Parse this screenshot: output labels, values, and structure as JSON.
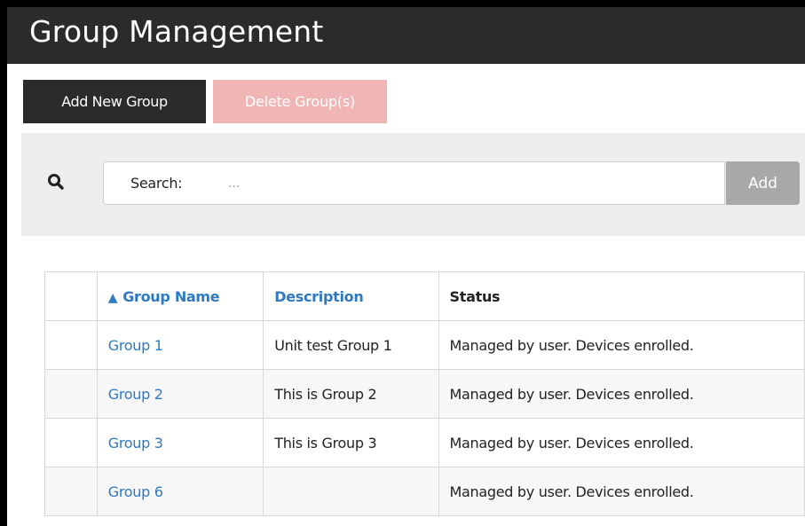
{
  "header": {
    "title": "Group Management"
  },
  "toolbar": {
    "add_group_label": "Add New Group",
    "delete_group_label": "Delete Group(s)"
  },
  "search": {
    "icon": "search-icon",
    "label": "Search:",
    "placeholder": "...",
    "value": "",
    "add_label": "Add"
  },
  "table": {
    "sort_indicator": "▲",
    "headers": {
      "select": "",
      "name": "Group Name",
      "description": "Description",
      "status": "Status"
    },
    "rows": [
      {
        "name": "Group 1",
        "description": "Unit test Group 1",
        "status": "Managed by user. Devices enrolled."
      },
      {
        "name": "Group 2",
        "description": "This is Group 2",
        "status": "Managed by user. Devices enrolled."
      },
      {
        "name": "Group 3",
        "description": "This is Group 3",
        "status": "Managed by user. Devices enrolled."
      },
      {
        "name": "Group 6",
        "description": "",
        "status": "Managed by user. Devices enrolled."
      }
    ]
  },
  "colors": {
    "titlebar": "#2b2b2b",
    "primary_button": "#2b2b2b",
    "danger_button_disabled": "#f0b5b5",
    "search_panel": "#eeeeee",
    "search_add_button": "#a8a8a8",
    "link": "#2e79c0"
  }
}
